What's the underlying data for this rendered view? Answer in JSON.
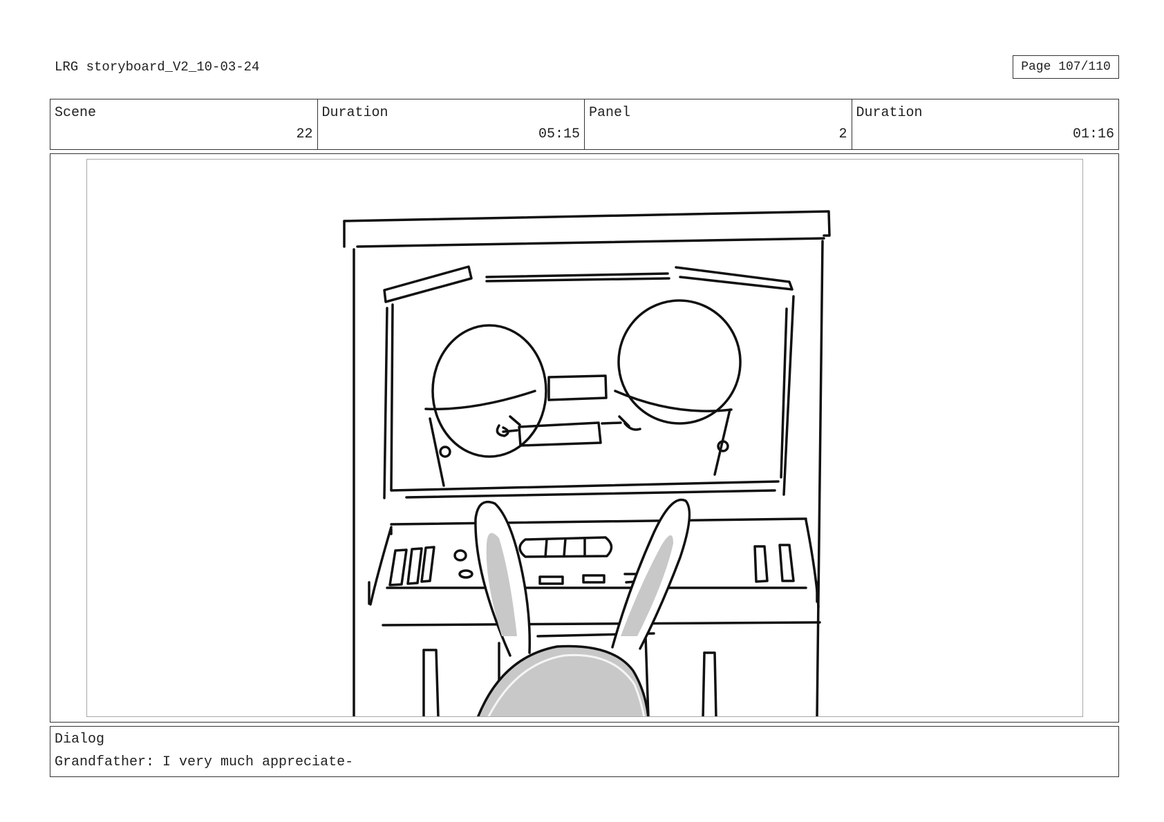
{
  "document": {
    "title": "LRG storyboard_V2_10-03-24",
    "page": "Page 107/110"
  },
  "info": {
    "scene_label": "Scene",
    "scene_value": "22",
    "scene_duration_label": "Duration",
    "scene_duration_value": "05:15",
    "panel_label": "Panel",
    "panel_value": "2",
    "panel_duration_label": "Duration",
    "panel_duration_value": "01:16"
  },
  "dialog": {
    "label": "Dialog",
    "text": "Grandfather: I very much appreciate-"
  }
}
